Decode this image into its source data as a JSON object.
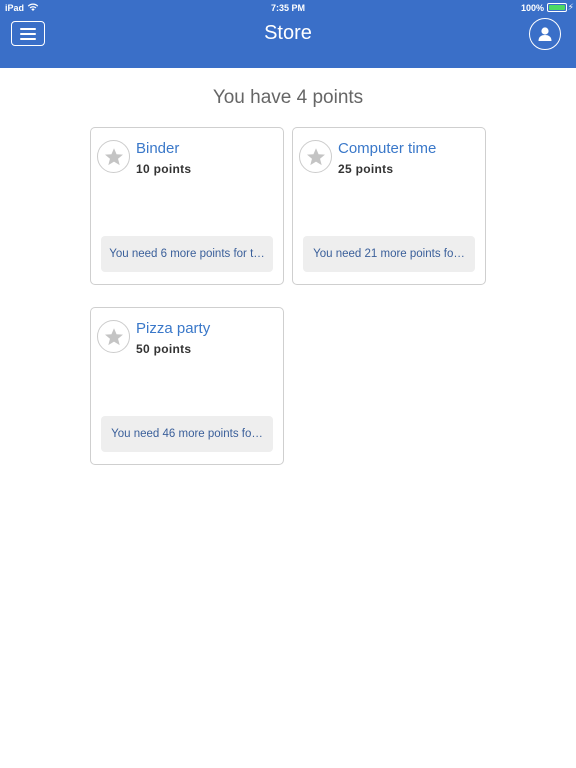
{
  "status_bar": {
    "carrier": "iPad",
    "time": "7:35 PM",
    "battery": "100%"
  },
  "header": {
    "title": "Store",
    "menu_icon": "hamburger-menu-icon",
    "profile_icon": "user-profile-icon",
    "background_color": "#3a6fc8"
  },
  "summary": {
    "points_text": "You have 4 points"
  },
  "items": [
    {
      "name": "Binder",
      "points": "10 points",
      "need_text": "You need 6 more points for t…",
      "icon": "star-icon"
    },
    {
      "name": "Computer time",
      "points": "25 points",
      "need_text": "You need 21 more points fo…",
      "icon": "star-icon"
    },
    {
      "name": "Pizza party",
      "points": "50 points",
      "need_text": "You need 46 more points fo…",
      "icon": "star-icon"
    }
  ]
}
